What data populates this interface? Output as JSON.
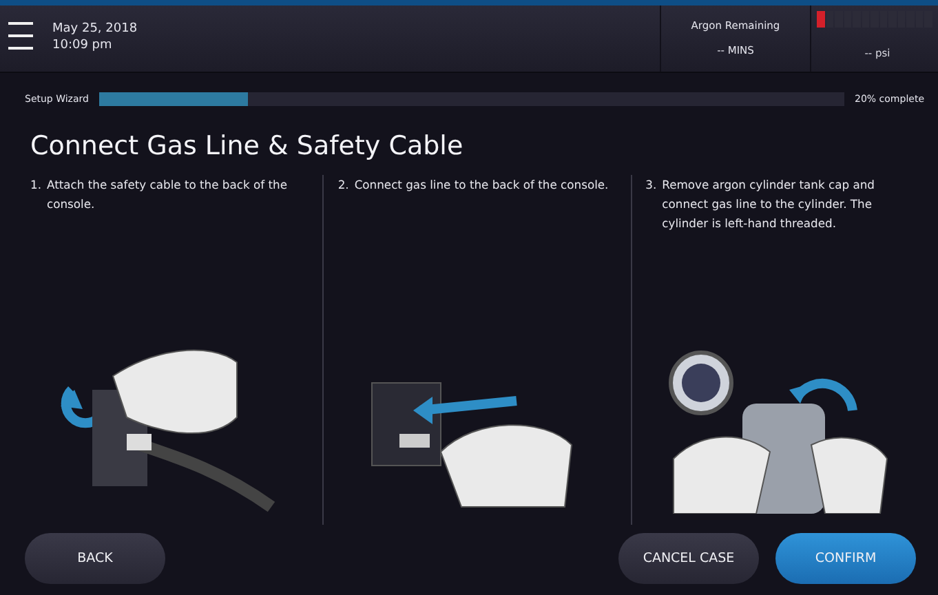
{
  "header": {
    "date": "May 25, 2018",
    "time": "10:09 pm",
    "argon": {
      "label": "Argon Remaining",
      "reading": "-- MINS"
    },
    "gauge": {
      "level": 0.08,
      "reading": "-- psi"
    }
  },
  "wizard": {
    "label": "Setup Wizard",
    "level": 0.2,
    "reading": "20% complete"
  },
  "title": "Connect Gas Line & Safety Cable",
  "steps": [
    {
      "number": "1.",
      "text": "Attach the safety cable to the back of the console.",
      "kind": "cable"
    },
    {
      "number": "2.",
      "text": "Connect gas line to the back of the console.",
      "kind": "plug"
    },
    {
      "number": "3.",
      "text": "Remove argon cylinder tank cap and connect gas line to the cylinder. The cylinder is left-hand threaded.",
      "kind": "cylinder"
    }
  ],
  "buttons": [
    {
      "label": "BACK",
      "kind": "secondary"
    },
    {
      "label": "CANCEL CASE",
      "kind": "secondary"
    },
    {
      "label": "CONFIRM",
      "kind": "primary"
    }
  ]
}
